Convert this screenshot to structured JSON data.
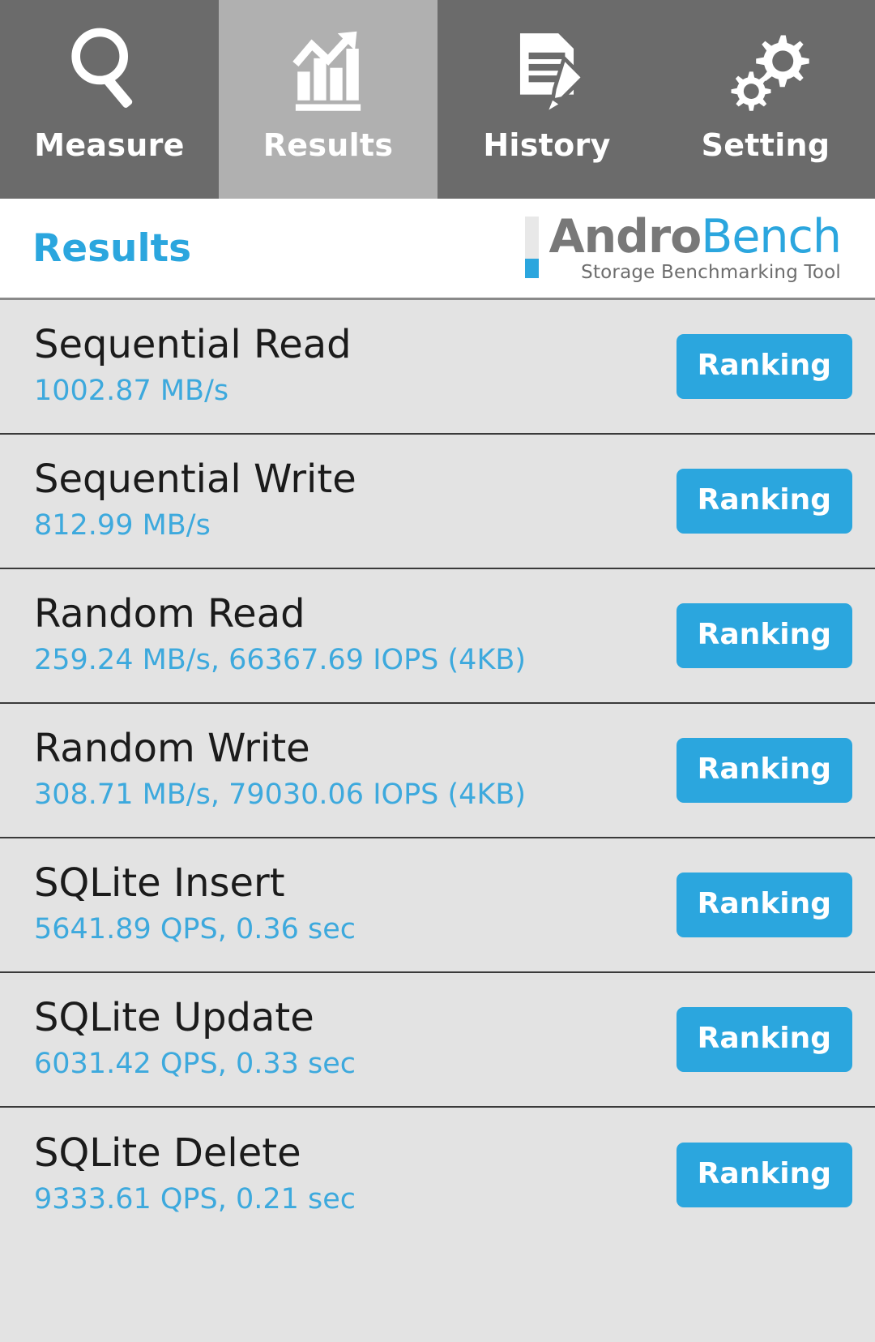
{
  "tabs": [
    {
      "label": "Measure",
      "icon": "magnifier-icon",
      "active": false
    },
    {
      "label": "Results",
      "icon": "bar-chart-icon",
      "active": true
    },
    {
      "label": "History",
      "icon": "document-pencil-icon",
      "active": false
    },
    {
      "label": "Setting",
      "icon": "gears-icon",
      "active": false
    }
  ],
  "header": {
    "title": "Results",
    "logo": {
      "word_primary": "Andro",
      "word_secondary": "Bench",
      "tagline": "Storage Benchmarking Tool"
    }
  },
  "results": [
    {
      "name": "Sequential Read",
      "value": "1002.87 MB/s",
      "button": "Ranking"
    },
    {
      "name": "Sequential Write",
      "value": "812.99 MB/s",
      "button": "Ranking"
    },
    {
      "name": "Random Read",
      "value": "259.24 MB/s, 66367.69 IOPS (4KB)",
      "button": "Ranking"
    },
    {
      "name": "Random Write",
      "value": "308.71 MB/s, 79030.06 IOPS (4KB)",
      "button": "Ranking"
    },
    {
      "name": "SQLite Insert",
      "value": "5641.89 QPS, 0.36 sec",
      "button": "Ranking"
    },
    {
      "name": "SQLite Update",
      "value": "6031.42 QPS, 0.33 sec",
      "button": "Ranking"
    },
    {
      "name": "SQLite Delete",
      "value": "9333.61 QPS, 0.21 sec",
      "button": "Ranking"
    }
  ],
  "colors": {
    "accent": "#2ba6de",
    "value_text": "#3da9dd",
    "tab_bg": "#6b6b6b",
    "tab_active_bg": "#b0b0b0",
    "row_bg": "#e3e3e3",
    "logo_gray": "#787878"
  }
}
